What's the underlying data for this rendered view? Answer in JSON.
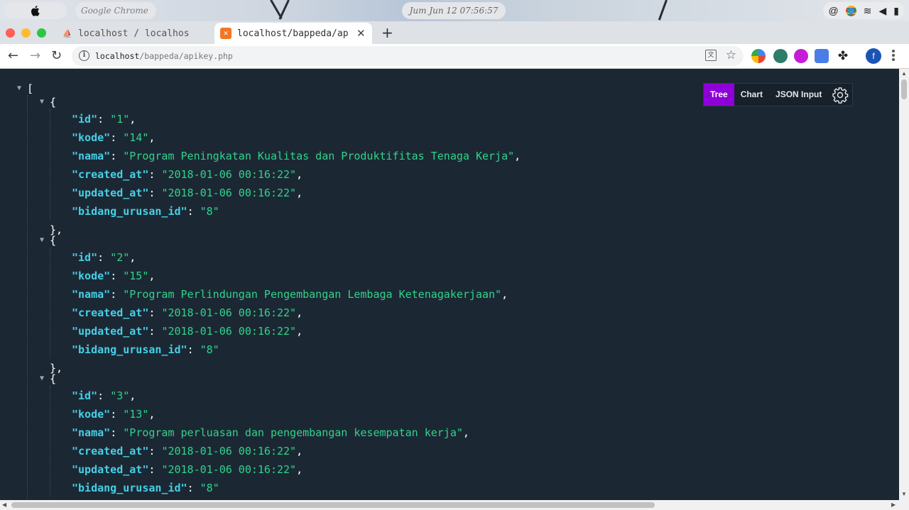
{
  "menubar": {
    "app_name": "Google Chrome",
    "clock": "Jum Jun 12 07:56:57"
  },
  "tabs": [
    {
      "label": "localhost / localhos",
      "icon": "phpmyadmin-icon",
      "active": false
    },
    {
      "label": "localhost/bappeda/ap",
      "icon": "xampp-icon",
      "active": true
    }
  ],
  "toolbar": {
    "url_host": "localhost",
    "url_path": "/bappeda/apikey.php",
    "profile_initial": "f"
  },
  "viewer": {
    "view_tabs": [
      "Tree",
      "Chart",
      "JSON Input"
    ],
    "active_view": "Tree",
    "records": [
      {
        "id": "1",
        "kode": "14",
        "nama": "Program Peningkatan Kualitas dan Produktifitas Tenaga Kerja",
        "created_at": "2018-01-06 00:16:22",
        "updated_at": "2018-01-06 00:16:22",
        "bidang_urusan_id": "8"
      },
      {
        "id": "2",
        "kode": "15",
        "nama": "Program Perlindungan Pengembangan Lembaga Ketenagakerjaan",
        "created_at": "2018-01-06 00:16:22",
        "updated_at": "2018-01-06 00:16:22",
        "bidang_urusan_id": "8"
      },
      {
        "id": "3",
        "kode": "13",
        "nama": "Program perluasan dan pengembangan kesempatan kerja",
        "created_at": "2018-01-06 00:16:22",
        "updated_at": "2018-01-06 00:16:22",
        "bidang_urusan_id": "8"
      }
    ]
  },
  "colors": {
    "background": "#1b2834",
    "key": "#47cfe6",
    "string": "#31d38a",
    "active_tab": "#8f00d8"
  }
}
